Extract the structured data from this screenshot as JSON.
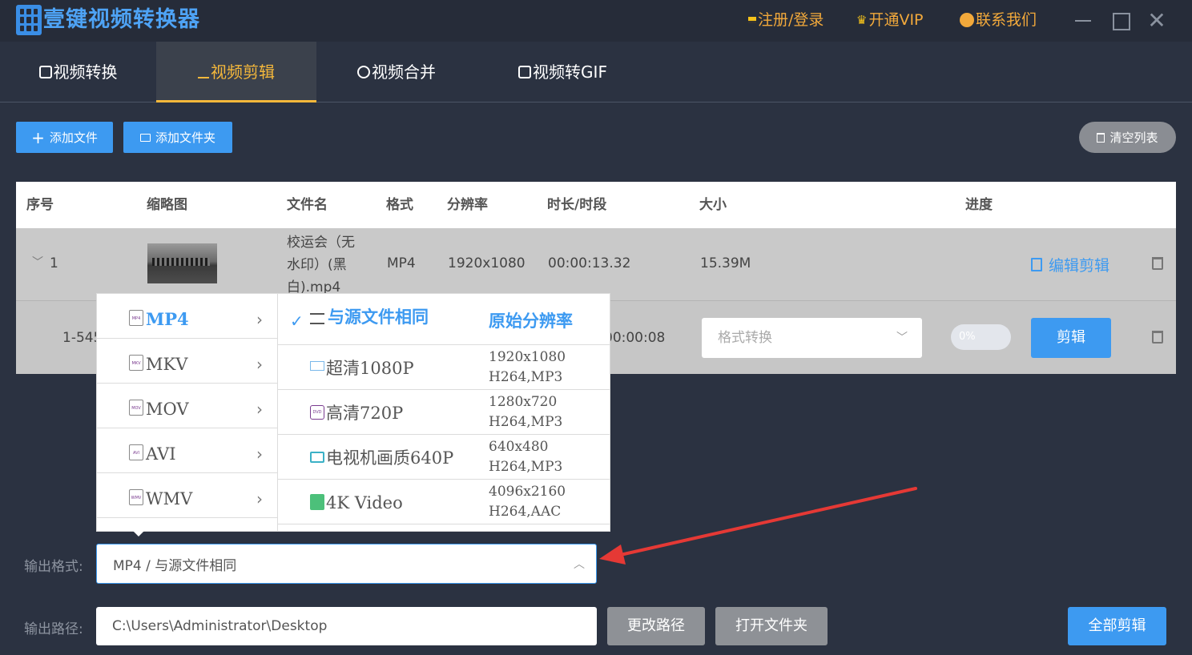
{
  "app": {
    "title": "壹键视频转换器",
    "register_login": "注册/登录",
    "vip": "开通VIP",
    "contact": "联系我们"
  },
  "tabs": [
    {
      "label": "视频转换",
      "active": false
    },
    {
      "label": "视频剪辑",
      "active": true
    },
    {
      "label": "视频合并",
      "active": false
    },
    {
      "label": "视频转GIF",
      "active": false
    }
  ],
  "toolbar": {
    "add_file": "添加文件",
    "add_folder": "添加文件夹",
    "clear_list": "清空列表"
  },
  "table": {
    "headers": [
      "序号",
      "缩略图",
      "文件名",
      "格式",
      "分辨率",
      "时长/时段",
      "大小",
      "进度"
    ],
    "rows": [
      {
        "index": "1",
        "filename_lines": [
          "校运会（无",
          "水印）(黑",
          "白).mp4"
        ],
        "format": "MP4",
        "resolution": "1920x1080",
        "duration": "00:00:13.32",
        "size": "15.39M",
        "edit_label": "编辑剪辑"
      }
    ],
    "sub_row": {
      "index": "1-545",
      "duration": "00:00:08",
      "format_placeholder": "格式转换",
      "progress": "0%",
      "clip_label": "剪辑"
    }
  },
  "format_menu": {
    "formats": [
      {
        "label": "MP4",
        "icon_text": "MP4",
        "active": true
      },
      {
        "label": "MKV",
        "icon_text": "MKV",
        "active": false
      },
      {
        "label": "MOV",
        "icon_text": "MOV",
        "active": false
      },
      {
        "label": "AVI",
        "icon_text": "AVI",
        "active": false
      },
      {
        "label": "WMV",
        "icon_text": "WMV",
        "active": false
      }
    ],
    "resolutions": [
      {
        "name": "与源文件相同",
        "dim1": "原始分辨率",
        "dim2": "",
        "selected": true,
        "icon": "sliders-icon",
        "icon_text": ""
      },
      {
        "name": "超清1080P",
        "dim1": "1920x1080",
        "dim2": "H264,MP3",
        "selected": false,
        "icon": "hd-icon",
        "icon_text": ""
      },
      {
        "name": "高清720P",
        "dim1": "1280x720",
        "dim2": "H264,MP3",
        "selected": false,
        "icon": "dvd-icon",
        "icon_text": "DVD"
      },
      {
        "name": "电视机画质640P",
        "dim1": "640x480",
        "dim2": "H264,MP3",
        "selected": false,
        "icon": "tv-icon",
        "icon_text": ""
      },
      {
        "name": "4K Video",
        "dim1": "4096x2160",
        "dim2": "H264,AAC",
        "selected": false,
        "icon": "film-icon",
        "icon_text": ""
      }
    ]
  },
  "output": {
    "format_label": "输出格式:",
    "format_value": "MP4 / 与源文件相同",
    "path_label": "输出路径:",
    "path_value": "C:\\Users\\Administrator\\Desktop",
    "change_path": "更改路径",
    "open_folder": "打开文件夹",
    "clip_all": "全部剪辑"
  },
  "colors": {
    "accent": "#3d9af1",
    "tab_active": "#f5b83b",
    "header_link": "#f2a93b",
    "arrow": "#e53935"
  }
}
